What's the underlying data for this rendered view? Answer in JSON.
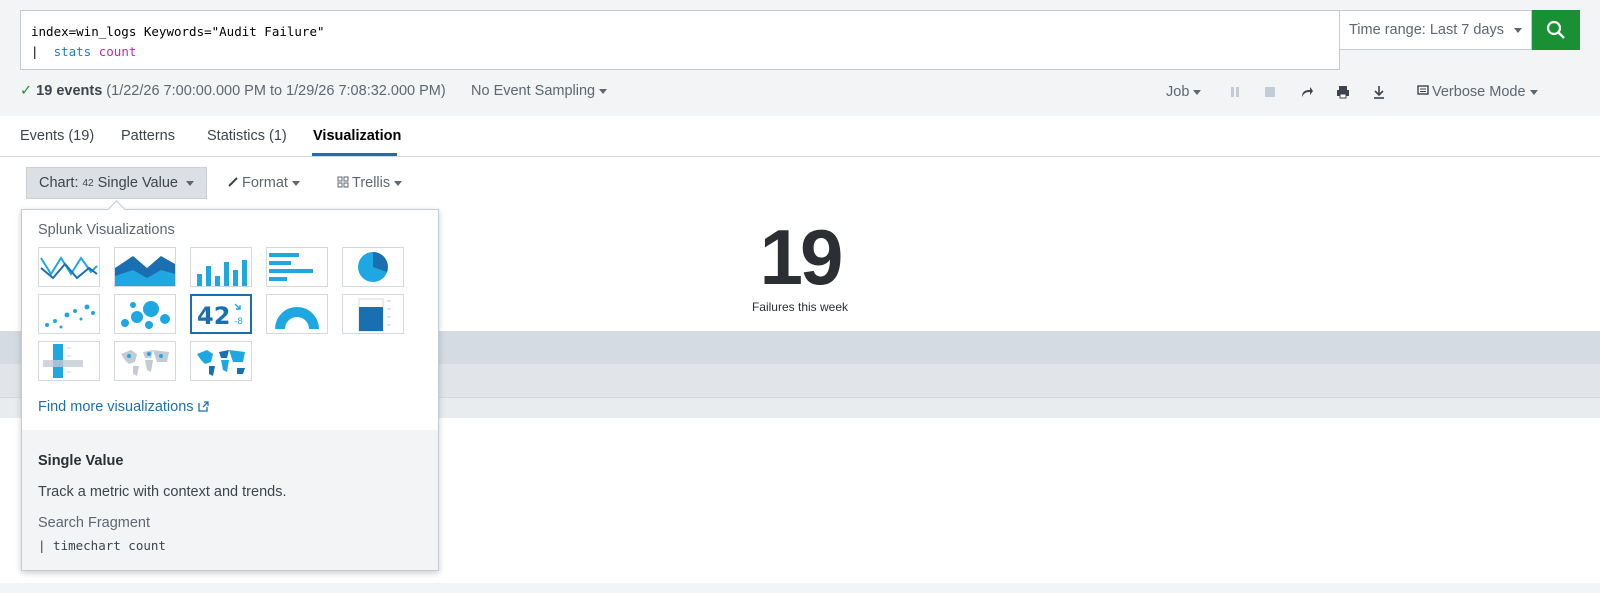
{
  "search": {
    "line1": "index=win_logs Keywords=\"Audit Failure\"",
    "line2_pipe": "|  ",
    "line2_cmd": "stats",
    "line2_fn": "count"
  },
  "time_range": {
    "label": "Time range: Last 7 days"
  },
  "status": {
    "count_label": "19 events",
    "range": "(1/22/26 7:00:00.000 PM to 1/29/26 7:08:32.000 PM)",
    "sampling": "No Event Sampling"
  },
  "toolbar": {
    "job": "Job",
    "mode": "Verbose Mode"
  },
  "tabs": [
    {
      "label": "Events (19)"
    },
    {
      "label": "Patterns"
    },
    {
      "label": "Statistics (1)"
    },
    {
      "label": "Visualization"
    }
  ],
  "chart_controls": {
    "chart_prefix": "Chart:",
    "chart_icon_text": "42",
    "chart_type": "Single Value",
    "format": "Format",
    "trellis": "Trellis"
  },
  "single_value": {
    "value": "19",
    "caption": "Failures this week"
  },
  "viz_panel": {
    "heading": "Splunk Visualizations",
    "thumbs": [
      "line-chart",
      "area-chart",
      "column-chart",
      "bar-chart",
      "pie-chart",
      "scatter-chart",
      "bubble-chart",
      "single-value",
      "radial-gauge",
      "filler-gauge",
      "marker-gauge",
      "cluster-map",
      "choropleth-map"
    ],
    "single_value_thumb": {
      "value": "42",
      "delta": "-8"
    },
    "find_more": "Find more visualizations",
    "detail": {
      "title": "Single Value",
      "description": "Track a metric with context and trends.",
      "fragment_label": "Search Fragment",
      "fragment": "| timechart count"
    }
  },
  "colors": {
    "accent": "#1a6fb0",
    "search_green": "#1a9035",
    "viz_blue": "#1ea7e1"
  }
}
